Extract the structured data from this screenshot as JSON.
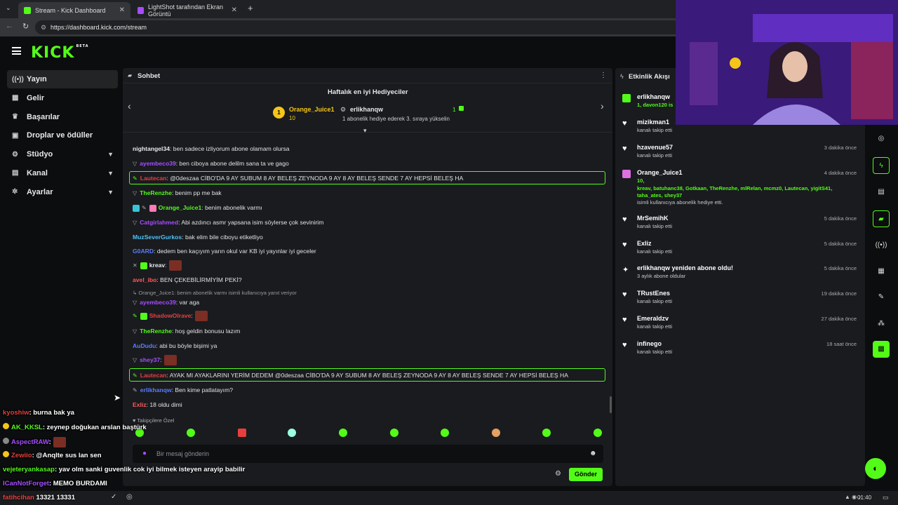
{
  "browser": {
    "tabs": [
      {
        "title": "Stream - Kick Dashboard"
      },
      {
        "title": "LightShot tarafından Ekran Görüntü"
      }
    ],
    "url": "https://dashboard.kick.com/stream"
  },
  "brand": {
    "logo": "KICK",
    "badge": "BETA",
    "accent": "#53fc18"
  },
  "sidebar": {
    "items": [
      {
        "label": "Yayın",
        "icon": "broadcast-icon"
      },
      {
        "label": "Gelir",
        "icon": "revenue-icon"
      },
      {
        "label": "Başarılar",
        "icon": "trophy-icon"
      },
      {
        "label": "Droplar ve ödüller",
        "icon": "gift-icon"
      },
      {
        "label": "Stüdyo",
        "icon": "studio-icon"
      },
      {
        "label": "Kanal",
        "icon": "channel-icon"
      },
      {
        "label": "Ayarlar",
        "icon": "gear-icon"
      }
    ]
  },
  "chat": {
    "title": "Sohbet",
    "gifters_title": "Haftalık en iyi Hediyeciler",
    "gifter1": {
      "rank": "1",
      "name": "Orange_Juice1",
      "count": "10"
    },
    "gifter2": {
      "name": "erlikhanqw",
      "count": "1",
      "hint": "1 abonelik hediye ederek 3. sıraya yükselin"
    },
    "messages": [
      {
        "user": "nightangel34",
        "text": ": ben sadece izliyorum abone olamam olursa",
        "color": "#e8e8e8"
      },
      {
        "user": "ayembeco39",
        "text": ": ben ciboya abone delilm sana ta ve gago",
        "color": "#a64dff"
      },
      {
        "user": "Lautecan",
        "text": ": @0deszaa CİBO'DA 9 AY SUBUM 8 AY BELEŞ ZEYNODA 9 AY 8 AY BELEŞ SENDE 7 AY HEPSİ BELEŞ HA",
        "color": "#e83e3e"
      },
      {
        "user": "TheRenzhe",
        "text": ": benim pp me bak",
        "color": "#53fc18"
      },
      {
        "user": "Orange_Juice1",
        "text": ": benim abonelik varmı",
        "color": "#53fc18"
      },
      {
        "user": "Catgirlahmed",
        "text": ": Abi azdıncı asmr yapsana isim söylerse çok sevinirim",
        "color": "#a64dff"
      },
      {
        "user": "MuzSeverGurkos",
        "text": ": bak elim bile ciboyu etiketliyo",
        "color": "#4fc3f7"
      },
      {
        "user": "G0ARD",
        "text": ": dedem ben kaçıyım yarın okul var KB iyi yayınlar iyi geceler",
        "color": "#5a7dff"
      },
      {
        "user": "kreav",
        "text": ":",
        "color": "#e8e8e8"
      },
      {
        "user": "avel_ibo",
        "text": ": BEN ÇEKEBİLİRMİYİM PEKİ?",
        "color": "#ff5a5a"
      },
      {
        "user": "ayembeco39",
        "text": ": var aga",
        "color": "#a64dff"
      },
      {
        "user": "ShadowOlrave",
        "text": ":",
        "color": "#e83e3e"
      },
      {
        "user": "TheRenzhe",
        "text": ": hoş geldin bonusu lazım",
        "color": "#53fc18"
      },
      {
        "user": "AuDudu",
        "text": ": abi bu böyle bişimi ya",
        "color": "#5a7dff"
      },
      {
        "user": "shey37",
        "text": ":",
        "color": "#a64dff"
      },
      {
        "user": "Lautecan",
        "text": ": AYAK MI AYAKLARINI YERİM DEDEM @0deszaa CİBO'DA 9 AY SUBUM 8 AY BELEŞ ZEYNODA 9 AY 8 AY BELEŞ SENDE 7 AY HEPSİ BELEŞ HA",
        "color": "#e83e3e"
      },
      {
        "user": "erlikhanqw",
        "text": ": Ben kime patlatayım?",
        "color": "#5a7dff"
      },
      {
        "user": "Exliz",
        "text": ": 18 oldu dimi",
        "color": "#ff5a5a"
      }
    ],
    "reply_note": "Orange_Juice1: benim abonelik varmı isimli kullanıcıya yanıt veriyor",
    "followers_label": "Takipçilere Özel",
    "input_placeholder": "Bir mesaj gönderin",
    "send_label": "Gönder"
  },
  "activity": {
    "title": "Etkinlik Akışı",
    "items": [
      {
        "name": "erlikhanqw",
        "desc": "1, davon120 is",
        "time": "",
        "icon": "gift-icon"
      },
      {
        "name": "mizikman1",
        "desc": "kanalı takip etti",
        "time": "",
        "icon": "heart-icon"
      },
      {
        "name": "hzavenue57",
        "desc": "kanalı takip etti",
        "time": "3 dakika önce",
        "icon": "heart-icon"
      },
      {
        "name": "Orange_Juice1",
        "desc": "10,",
        "desc2": "kreav, batuhanc38, Gotkaan, TheRenzhe, mlRelan, mcmz0, Lautecan, yigitS41,",
        "desc3": "taha_ates, shey37",
        "desc4": "isimli kullanıcıya abonelik hediye etti.",
        "time": "4 dakika önce",
        "icon": "gift-icon"
      },
      {
        "name": "MrSemihK",
        "desc": "kanalı takip etti",
        "time": "5 dakika önce",
        "icon": "heart-icon"
      },
      {
        "name": "Exliz",
        "desc": "kanalı takip etti",
        "time": "5 dakika önce",
        "icon": "heart-icon"
      },
      {
        "name": "erlikhanqw yeniden abone oldu!",
        "desc": "3 aylık abone oldular",
        "time": "5 dakika önce",
        "icon": "star-icon"
      },
      {
        "name": "TRustEnes",
        "desc": "kanalı takip etti",
        "time": "19 dakika önce",
        "icon": "heart-icon"
      },
      {
        "name": "Emeraldzv",
        "desc": "kanalı takip etti",
        "time": "27 dakika önce",
        "icon": "heart-icon"
      },
      {
        "name": "infinego",
        "desc": "kanalı takip etti",
        "time": "18 saat önce",
        "icon": "heart-icon"
      }
    ]
  },
  "overlay_chat": [
    {
      "user": "kyoshiw",
      "text": ": burna bak ya",
      "color": "#e83e3e"
    },
    {
      "user": "AK_KKSL",
      "text": ": zeynep doğukan arslan baştürk",
      "color": "#53fc18"
    },
    {
      "user": "AspectRAW",
      "text": ":",
      "color": "#a64dff"
    },
    {
      "user": "Zewiio",
      "text": ": @Anqlte sus lan sen",
      "color": "#e83e3e"
    },
    {
      "user": "vejeteryankasap",
      "text": ": yav olm sanki guvenlik cok iyi bilmek isteyen arayip babilir",
      "color": "#53fc18"
    },
    {
      "user": "ICanNotForget",
      "text": ": MEMO BURDAMI",
      "color": "#a64dff"
    },
    {
      "user": "fatihcihan",
      "text": "13321 13331",
      "color": "#e83e3e"
    }
  ],
  "taskbar": {
    "time": "01:40"
  }
}
